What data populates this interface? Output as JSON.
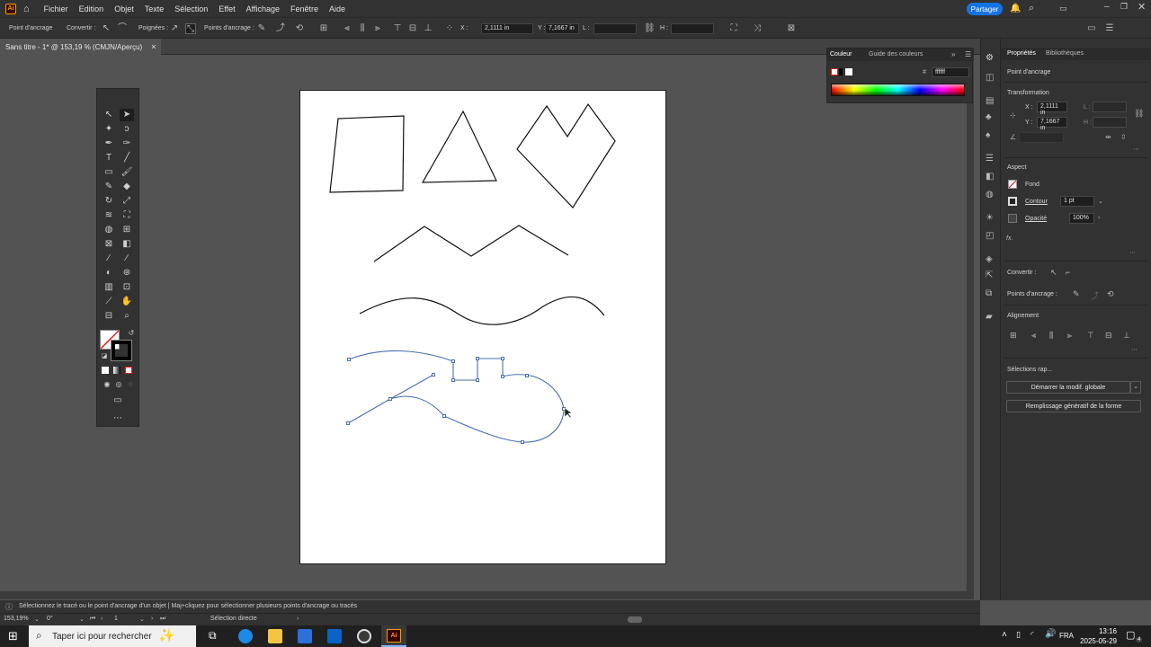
{
  "app": {
    "logo": "Ai",
    "share_label": "Partager"
  },
  "menu": [
    "Fichier",
    "Edition",
    "Objet",
    "Texte",
    "Sélection",
    "Effet",
    "Affichage",
    "Fenêtre",
    "Aide"
  ],
  "control_bar": {
    "mode_label": "Point d'ancrage",
    "convert_label": "Convertir :",
    "handles_label": "Poignées :",
    "anchors_label": "Points d'ancrage :",
    "x_label": "X :",
    "x_value": "2,1111 in",
    "y_label": "Y :",
    "y_value": "7,1667 in",
    "l_label": "L :",
    "h_label": "H :"
  },
  "document_tab": {
    "title": "Sans titre - 1* @ 153,19 % (CMJN/Aperçu)",
    "close": "×"
  },
  "color_panel": {
    "tab_color": "Couleur",
    "tab_guide": "Guide des couleurs",
    "hex_symbol": "#",
    "hex_value": "ffffff"
  },
  "properties": {
    "tab_props": "Propriétés",
    "tab_libs": "Bibliothèques",
    "selection_type": "Point d'ancrage",
    "transform_title": "Transformation",
    "x_label": "X :",
    "x_value": "2,1111 in",
    "y_label": "Y :",
    "y_value": "7,1667 in",
    "l_label": "L :",
    "h_label": "H :",
    "aspect_title": "Aspect",
    "fill_label": "Fond",
    "stroke_label": "Contour",
    "stroke_value": "1 pt",
    "opacity_label": "Opacité",
    "opacity_value": "100%",
    "fx_label": "fx.",
    "convert_label": "Convertir :",
    "anchors_label": "Points d'ancrage :",
    "align_title": "Alignement",
    "quick_title": "Sélections rap...",
    "btn_global": "Démarrer la modif. globale",
    "btn_generative": "Remplissage génératif de la forme"
  },
  "status": {
    "hint": "Sélectionnez le tracé ou le point d'ancrage d'un objet  |  Maj+cliquez pour sélectionner plusieurs points d'ancrage ou tracés"
  },
  "bottom": {
    "zoom": "153,19%",
    "rotation": "0°",
    "artboard": "1",
    "tool": "Sélection directe"
  },
  "taskbar": {
    "search_placeholder": "Taper ici pour rechercher",
    "lang": "FRA",
    "time": "13:16",
    "date": "2025-05-29",
    "notif_count": "4"
  },
  "colors": {
    "ui_dark": "#323232",
    "canvas": "#535353",
    "accent": "#1473e6",
    "selection": "#4b6eaf",
    "ai_orange": "#ff9a00"
  }
}
